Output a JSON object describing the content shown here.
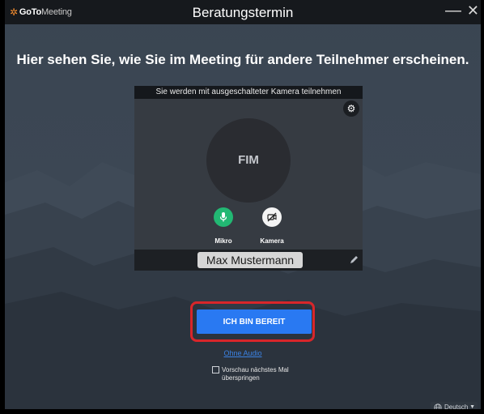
{
  "app": {
    "logo_bold": "GoTo",
    "logo_regular": "Meeting",
    "window_title": "Beratungstermin",
    "minimize_glyph": "—",
    "close_glyph": "✕"
  },
  "headline": "Hier sehen Sie, wie Sie im Meeting für andere Teilnehmer erscheinen.",
  "preview": {
    "camera_notice": "Sie werden mit ausgeschalteter Kamera teilnehmen",
    "initials": "FIM",
    "mic_label": "Mikro",
    "camera_label": "Kamera",
    "name_value": "Max Mustermann",
    "settings_icon": "gear-icon",
    "edit_icon": "pencil-icon"
  },
  "actions": {
    "ready_label": "ICH BIN BEREIT",
    "no_audio_label": "Ohne Audio",
    "skip_preview_label": "Vorschau nächstes Mal überspringen",
    "skip_preview_checked": false
  },
  "language": {
    "selected": "Deutsch"
  },
  "colors": {
    "brand_orange": "#f68d2e",
    "primary_button": "#2979f2",
    "mic_on": "#22b873",
    "highlight_outline": "#d8262a",
    "link": "#3b82e3"
  }
}
